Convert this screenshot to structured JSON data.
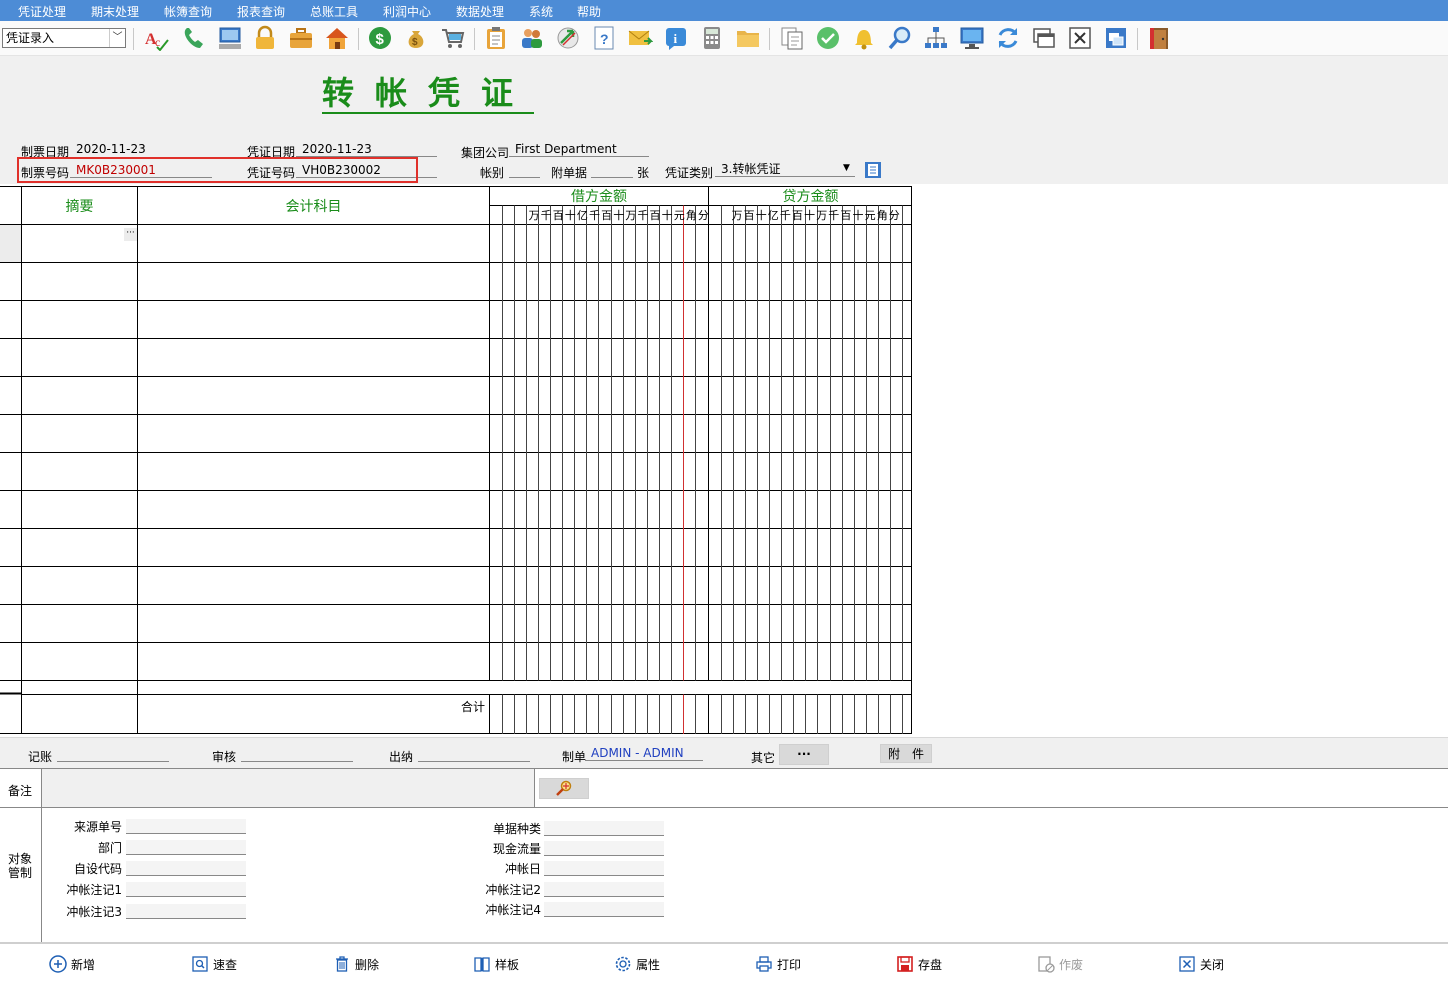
{
  "menu": [
    "凭证处理",
    "期末处理",
    "帐簿查询",
    "报表查询",
    "总账工具",
    "利润中心",
    "数据处理",
    "系统",
    "帮助"
  ],
  "toolbar": {
    "mode": "凭证录入"
  },
  "form": {
    "title": "转帐凭证",
    "make_date_label": "制票日期",
    "make_date": "2020-11-23",
    "voucher_date_label": "凭证日期",
    "voucher_date": "2020-11-23",
    "company_label": "集团公司",
    "company": "First Department",
    "make_no_label": "制票号码",
    "make_no": "MK0B230001",
    "voucher_no_label": "凭证号码",
    "voucher_no": "VH0B230002",
    "book_label": "帐别",
    "book": "",
    "attach_label": "附单据",
    "attach": "",
    "attach_unit": "张",
    "type_label": "凭证类别",
    "type": "3.转帐凭证"
  },
  "table": {
    "summary_header": "摘要",
    "account_header": "会计科目",
    "debit_header": "借方金额",
    "credit_header": "贷方金额",
    "debit_units": [
      "万",
      "千",
      "百",
      "十",
      "亿",
      "千",
      "百",
      "十",
      "万",
      "千",
      "百",
      "十",
      "元",
      "角",
      "分"
    ],
    "credit_units": [
      "万",
      "百",
      "十",
      "亿",
      "千",
      "百",
      "十",
      "万",
      "千",
      "百",
      "十",
      "元",
      "角",
      "分"
    ],
    "ellipsis": "···",
    "total_label": "合计",
    "row_count": 12
  },
  "signatures": {
    "post_label": "记账",
    "post": "",
    "audit_label": "审核",
    "audit": "",
    "cashier_label": "出纳",
    "cashier": "",
    "maker_label": "制单",
    "maker": "ADMIN - ADMIN",
    "other_label": "其它",
    "other_btn": "···",
    "attachment_btn": "附　件"
  },
  "remark": {
    "label": "备注",
    "value": ""
  },
  "object": {
    "section_label": "对象管制",
    "left": [
      {
        "label": "来源单号",
        "value": ""
      },
      {
        "label": "部门",
        "value": ""
      },
      {
        "label": "自设代码",
        "value": ""
      },
      {
        "label": "冲帐注记1",
        "value": ""
      },
      {
        "label": "冲帐注记3",
        "value": ""
      }
    ],
    "right": [
      {
        "label": "单据种类",
        "value": ""
      },
      {
        "label": "现金流量",
        "value": ""
      },
      {
        "label": "冲帐日",
        "value": ""
      },
      {
        "label": "冲帐注记2",
        "value": ""
      },
      {
        "label": "冲帐注记4",
        "value": ""
      }
    ]
  },
  "actions": [
    {
      "label": "新增",
      "icon": "plus-circle-icon",
      "color": "#1e5fb4"
    },
    {
      "label": "速查",
      "icon": "quick-search-icon",
      "color": "#1e5fb4"
    },
    {
      "label": "删除",
      "icon": "trash-icon",
      "color": "#1e5fb4"
    },
    {
      "label": "样板",
      "icon": "book-icon",
      "color": "#1e5fb4"
    },
    {
      "label": "属性",
      "icon": "gear-icon",
      "color": "#1e5fb4"
    },
    {
      "label": "打印",
      "icon": "printer-icon",
      "color": "#1e5fb4"
    },
    {
      "label": "存盘",
      "icon": "save-icon",
      "color": "#d42020"
    },
    {
      "label": "作废",
      "icon": "void-icon",
      "color": "#9a9a9a"
    },
    {
      "label": "关闭",
      "icon": "close-icon",
      "color": "#1e5fb4"
    }
  ],
  "colors": {
    "menu_bg": "#4d8cd6",
    "title_green": "#1a8c1a",
    "highlight_red": "#e0302a",
    "red_line": "#d03030",
    "maker_blue": "#2040c0"
  }
}
